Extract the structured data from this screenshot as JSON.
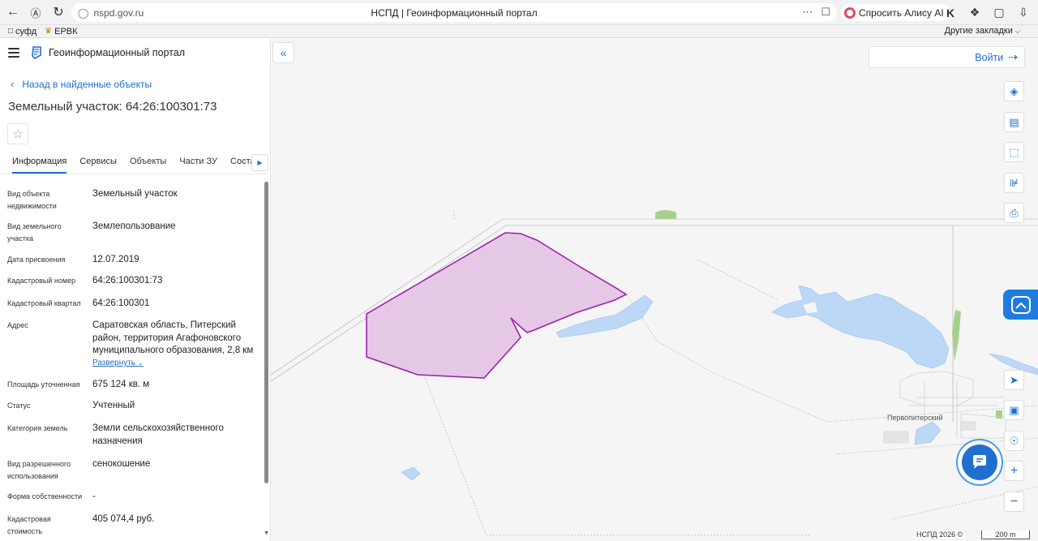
{
  "browser": {
    "url": "nspd.gov.ru",
    "tab_title": "НСПД | Геоинформационный портал",
    "alice_label": "Спросить Алису AI",
    "bookmarks": [
      {
        "label": "суфд"
      },
      {
        "label": "ЕРВК"
      }
    ],
    "other_bookmarks": "Другие закладки"
  },
  "panel": {
    "portal_name": "Геоинформационный портал",
    "back_link": "Назад в найденные объекты",
    "title": "Земельный участок: 64:26:100301:73",
    "tabs": [
      {
        "label": "Информация",
        "active": true
      },
      {
        "label": "Сервисы"
      },
      {
        "label": "Объекты"
      },
      {
        "label": "Части ЗУ"
      },
      {
        "label": "Состав"
      }
    ],
    "properties": [
      {
        "label": "Вид объекта недвижимости",
        "value": "Земельный участок"
      },
      {
        "label": "Вид земельного участка",
        "value": "Землепользование"
      },
      {
        "label": "Дата присвоения",
        "value": "12.07.2019"
      },
      {
        "label": "Кадастровый номер",
        "value": "64:26:100301:73"
      },
      {
        "label": "Кадастровый квартал",
        "value": "64:26:100301"
      },
      {
        "label": "Адрес",
        "value": "Саратовская область, Питерский район, территория Агафоновского муниципального образования, 2,8 км"
      },
      {
        "label": "Площадь уточненная",
        "value": "675 124 кв. м"
      },
      {
        "label": "Статус",
        "value": "Учтенный"
      },
      {
        "label": "Категория земель",
        "value": "Земли сельскохозяйственного назначения"
      },
      {
        "label": "Вид разрешенного использования",
        "value": "сенокошение"
      },
      {
        "label": "Форма собственности",
        "value": "-"
      },
      {
        "label": "Кадастровая стоимость",
        "value": "405 074,4 руб."
      }
    ],
    "expand_label": "Развернуть"
  },
  "map": {
    "login_label": "Войти",
    "settlement": "Первопитерский",
    "attribution": "НСПД 2026 ©",
    "scale_label": "200 m",
    "colors": {
      "parcel_fill": "#e5c8e6",
      "parcel_stroke": "#a020b0",
      "water": "#bcd8f6",
      "accent": "#1f6fd1"
    },
    "tools": [
      "layers-icon",
      "ruler-icon",
      "search-area-icon",
      "share-icon",
      "print-icon",
      "locate-icon",
      "minimap-icon",
      "geo-icon",
      "zoom-in-icon",
      "zoom-out-icon"
    ]
  }
}
